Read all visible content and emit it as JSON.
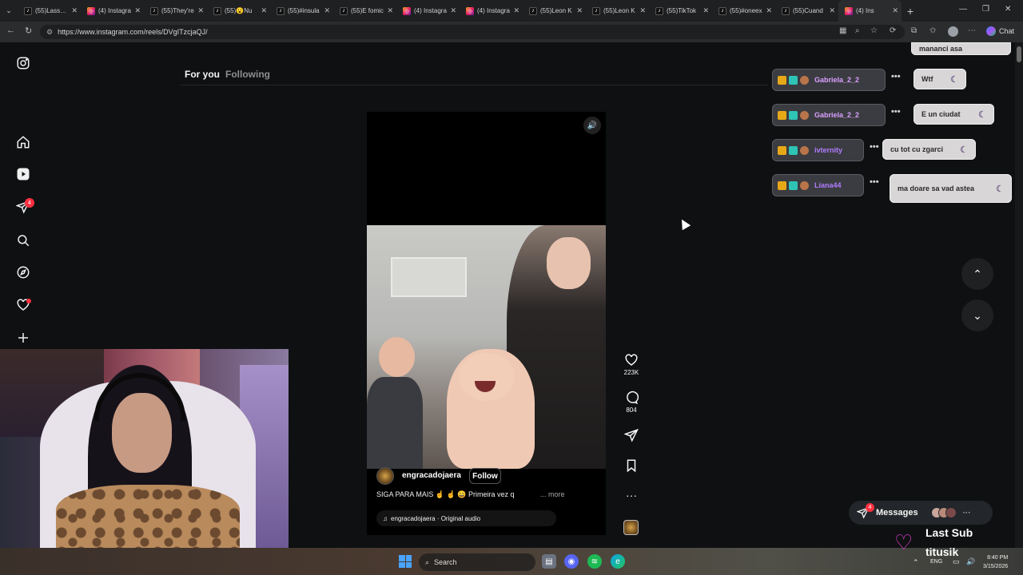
{
  "browser": {
    "tabs": [
      {
        "icon": "tiktok",
        "title": "(55)Lasssss"
      },
      {
        "icon": "instagram",
        "title": "(4) Instagra"
      },
      {
        "icon": "tiktok",
        "title": "(55)They're"
      },
      {
        "icon": "tiktok",
        "title": "(55)😮Nu"
      },
      {
        "icon": "tiktok",
        "title": "(55)#insula"
      },
      {
        "icon": "tiktok",
        "title": "(55)E fomic"
      },
      {
        "icon": "instagram",
        "title": "(4) Instagra"
      },
      {
        "icon": "instagram",
        "title": "(4) Instagra"
      },
      {
        "icon": "tiktok",
        "title": "(55)Leon K"
      },
      {
        "icon": "tiktok",
        "title": "(55)Leon K"
      },
      {
        "icon": "tiktok",
        "title": "(55)TikTok"
      },
      {
        "icon": "tiktok",
        "title": "(55)#oneex"
      },
      {
        "icon": "tiktok",
        "title": "(55)Cuand"
      },
      {
        "icon": "instagram",
        "title": "(4) Ins"
      }
    ],
    "url": "https://www.instagram.com/reels/DVgITzcjaQJ/",
    "chat_label": "Chat"
  },
  "instagram": {
    "tabs": {
      "for_you": "For you",
      "following": "Following"
    },
    "notification_count": "4",
    "reel": {
      "username": "engracadojaera",
      "follow_label": "Follow",
      "caption": "SIGA PARA MAIS ☝️ ☝️ 😄 Primeira vez q",
      "more_label": "... more",
      "audio": "engracadojaera · Original audio"
    },
    "actions": {
      "likes": "223K",
      "comments": "804"
    },
    "messages": {
      "label": "Messages",
      "badge": "4"
    }
  },
  "stream_chat": {
    "partial_top": "mananci asa",
    "messages": [
      {
        "user": "Gabriela_2_2",
        "text": "Wtf",
        "user_color": "#d9a0ff"
      },
      {
        "user": "Gabriela_2_2",
        "text": "E un ciudat",
        "user_color": "#d9a0ff"
      },
      {
        "user": "ivternity",
        "text": "cu tot cu zgarci",
        "user_color": "#b07cff"
      },
      {
        "user": "Liana44",
        "text": "ma doare sa vad astea",
        "user_color": "#b07cff"
      }
    ]
  },
  "stream_overlay": {
    "last_sub_title": "Last Sub",
    "last_sub_name": "titusik"
  },
  "taskbar": {
    "search_label": "Search",
    "lang": "ENG",
    "time": "8:40 PM",
    "date": "3/15/2026"
  }
}
